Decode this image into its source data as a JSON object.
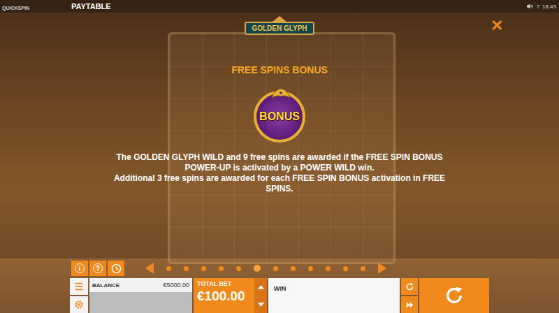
{
  "top_bar": {
    "brand": "QUICKSPIN",
    "title": "PAYTABLE",
    "help": "?",
    "clock": "18:43"
  },
  "logo": "GOLDEN GLYPH",
  "close": "✕",
  "section": {
    "title": "FREE SPINS BONUS",
    "badge": "BONUS",
    "paragraphs": [
      "The GOLDEN GLYPH WILD and 9 free spins are awarded if the FREE SPIN BONUS POWER-UP is activated by a POWER WILD win.",
      "Additional 3 free spins are awarded for each FREE SPIN BONUS activation in FREE SPINS."
    ]
  },
  "tool_buttons": [
    {
      "kind": "info",
      "glyph": "i"
    },
    {
      "kind": "help",
      "glyph": "?"
    }
  ],
  "pagination": {
    "pages": [
      {
        "selected": false
      },
      {
        "selected": false
      },
      {
        "selected": false
      },
      {
        "selected": false
      },
      {
        "selected": false
      },
      {
        "selected": true
      },
      {
        "selected": false
      },
      {
        "selected": false
      },
      {
        "selected": false
      },
      {
        "selected": false
      },
      {
        "selected": false
      },
      {
        "selected": false
      }
    ]
  },
  "controls": {
    "balance_label": "BALANCE",
    "balance": "€5000.00",
    "total_bet_label": "TOTAL BET",
    "total_bet": "€100.00",
    "win_label": "WIN"
  }
}
